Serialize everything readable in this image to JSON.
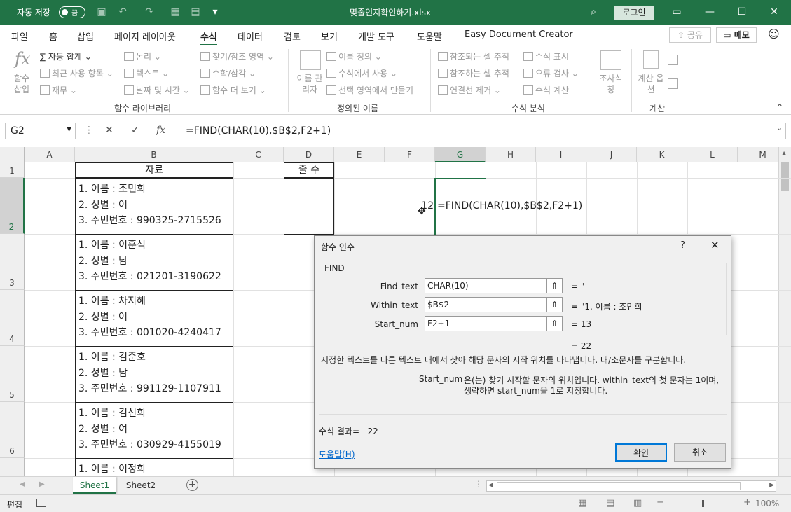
{
  "titlebar": {
    "autosave_label": "자동 저장",
    "autosave_state": "끔",
    "filename": "몇줄인지확인하기.xlsx",
    "login_label": "로그인"
  },
  "menu": {
    "items": [
      "파일",
      "홈",
      "삽입",
      "페이지 레이아웃",
      "수식",
      "데이터",
      "검토",
      "보기",
      "개발 도구",
      "도움말",
      "Easy Document Creator"
    ],
    "active": "수식",
    "share": "공유",
    "memo": "메모"
  },
  "ribbon": {
    "insert_function": "함수 삽입",
    "autosum": "자동 합계",
    "recent": "최근 사용 항목",
    "financial": "재무",
    "logical": "논리",
    "text": "텍스트",
    "datetime": "날짜 및 시간",
    "lookup": "찾기/참조 영역",
    "math": "수학/삼각",
    "more": "함수 더 보기",
    "group_library": "함수 라이브러리",
    "name_manager": "이름 관리자",
    "define_name": "이름 정의",
    "use_in_formula": "수식에서 사용",
    "create_from_selection": "선택 영역에서 만들기",
    "group_names": "정의된 이름",
    "trace_precedents": "참조되는 셀 추적",
    "trace_dependents": "참조하는 셀 추적",
    "remove_arrows": "연결선 제거",
    "show_formulas": "수식 표시",
    "error_checking": "오류 검사",
    "evaluate": "수식 계산",
    "group_audit": "수식 분석",
    "watch_window": "조사식 창",
    "calc_options": "계산 옵션",
    "group_calc": "계산"
  },
  "formula_bar": {
    "name_box": "G2",
    "formula": "=FIND(CHAR(10),$B$2,F2+1)"
  },
  "columns": [
    "A",
    "B",
    "C",
    "D",
    "E",
    "F",
    "G",
    "H",
    "I",
    "J",
    "K",
    "L",
    "M"
  ],
  "rows": [
    "1",
    "2",
    "3",
    "4",
    "5",
    "6"
  ],
  "sheet": {
    "b1": "자료",
    "d1": "줄 수",
    "f2": "12",
    "g2": "=FIND(CHAR(10),$B$2,F2+1)",
    "records": [
      {
        "line1": "1. 이름 : 조민희",
        "line2": "2. 성별 : 여",
        "line3": "3. 주민번호 : 990325-2715526"
      },
      {
        "line1": "1. 이름 : 이훈석",
        "line2": "2. 성별 : 남",
        "line3": "3. 주민번호 : 021201-3190622"
      },
      {
        "line1": "1. 이름 : 차지혜",
        "line2": "2. 성별 : 여",
        "line3": "3. 주민번호 : 001020-4240417"
      },
      {
        "line1": "1. 이름 : 김준호",
        "line2": "2. 성별 : 남",
        "line3": "3. 주민번호 : 991129-1107911"
      },
      {
        "line1": "1. 이름 : 김선희",
        "line2": "2. 성별 : 여",
        "line3": "3. 주민번호 : 030929-4155019"
      },
      {
        "line1": "1. 이름 : 이정희"
      }
    ]
  },
  "dialog": {
    "title": "함수 인수",
    "help_q": "?",
    "func_name": "FIND",
    "args": [
      {
        "label": "Find_text",
        "value": "CHAR(10)",
        "result": "= \""
      },
      {
        "label": "Within_text",
        "value": "$B$2",
        "result": "= \"1. 이름 : 조민희"
      },
      {
        "label": "Start_num",
        "value": "F2+1",
        "result": "= 13"
      }
    ],
    "result_line": "= 22",
    "description": "지정한 텍스트를 다른 텍스트 내에서 찾아 해당 문자의 시작 위치를 나타냅니다. 대/소문자를 구분합니다.",
    "arg_help_name": "Start_num",
    "arg_help_line1": "은(는) 찾기 시작할 문자의 위치입니다. within_text의 첫 문자는 1이며,",
    "arg_help_line2": "생략하면 start_num을 1로 지정합니다.",
    "formula_result": "수식 결과=   22",
    "help_link": "도움말(H)",
    "ok": "확인",
    "cancel": "취소"
  },
  "tabs": {
    "sheet1": "Sheet1",
    "sheet2": "Sheet2"
  },
  "status": {
    "mode": "편집",
    "zoom": "100%"
  }
}
